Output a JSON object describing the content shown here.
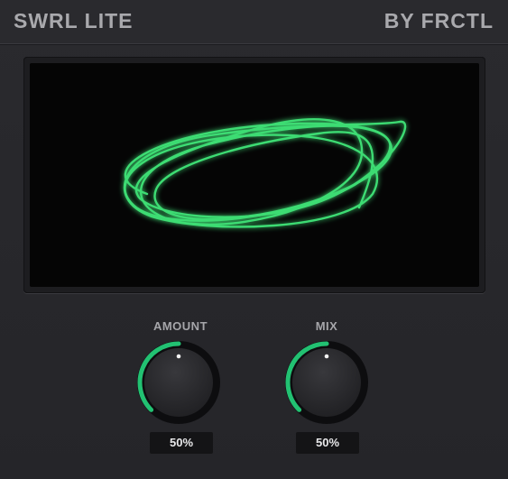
{
  "header": {
    "title": "SWRL LITE",
    "brand": "BY FRCTL"
  },
  "scope": {
    "trace_color": "#3ddc73",
    "background": "#050505"
  },
  "knobs": [
    {
      "label": "AMOUNT",
      "value_text": "50%",
      "value": 0.5
    },
    {
      "label": "MIX",
      "value_text": "50%",
      "value": 0.5
    }
  ],
  "colors": {
    "accent": "#22c172",
    "panel": "#29292d",
    "text": "#a9a9ad"
  }
}
